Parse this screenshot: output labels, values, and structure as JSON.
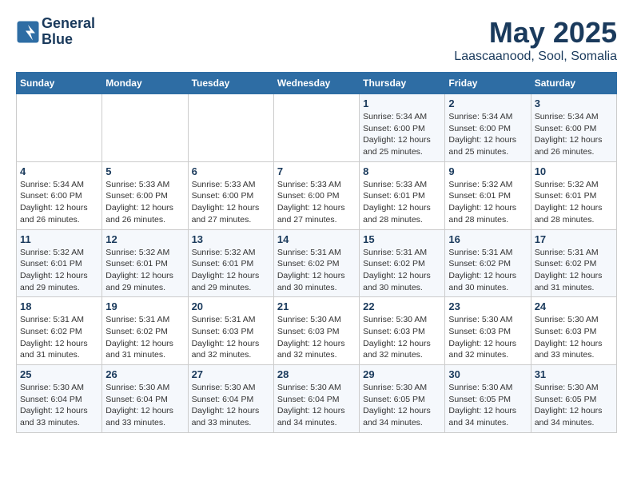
{
  "header": {
    "logo_line1": "General",
    "logo_line2": "Blue",
    "title": "May 2025",
    "subtitle": "Laascaanood, Sool, Somalia"
  },
  "days_of_week": [
    "Sunday",
    "Monday",
    "Tuesday",
    "Wednesday",
    "Thursday",
    "Friday",
    "Saturday"
  ],
  "weeks": [
    [
      {
        "day": "",
        "info": ""
      },
      {
        "day": "",
        "info": ""
      },
      {
        "day": "",
        "info": ""
      },
      {
        "day": "",
        "info": ""
      },
      {
        "day": "1",
        "info": "Sunrise: 5:34 AM\nSunset: 6:00 PM\nDaylight: 12 hours\nand 25 minutes."
      },
      {
        "day": "2",
        "info": "Sunrise: 5:34 AM\nSunset: 6:00 PM\nDaylight: 12 hours\nand 25 minutes."
      },
      {
        "day": "3",
        "info": "Sunrise: 5:34 AM\nSunset: 6:00 PM\nDaylight: 12 hours\nand 26 minutes."
      }
    ],
    [
      {
        "day": "4",
        "info": "Sunrise: 5:34 AM\nSunset: 6:00 PM\nDaylight: 12 hours\nand 26 minutes."
      },
      {
        "day": "5",
        "info": "Sunrise: 5:33 AM\nSunset: 6:00 PM\nDaylight: 12 hours\nand 26 minutes."
      },
      {
        "day": "6",
        "info": "Sunrise: 5:33 AM\nSunset: 6:00 PM\nDaylight: 12 hours\nand 27 minutes."
      },
      {
        "day": "7",
        "info": "Sunrise: 5:33 AM\nSunset: 6:00 PM\nDaylight: 12 hours\nand 27 minutes."
      },
      {
        "day": "8",
        "info": "Sunrise: 5:33 AM\nSunset: 6:01 PM\nDaylight: 12 hours\nand 28 minutes."
      },
      {
        "day": "9",
        "info": "Sunrise: 5:32 AM\nSunset: 6:01 PM\nDaylight: 12 hours\nand 28 minutes."
      },
      {
        "day": "10",
        "info": "Sunrise: 5:32 AM\nSunset: 6:01 PM\nDaylight: 12 hours\nand 28 minutes."
      }
    ],
    [
      {
        "day": "11",
        "info": "Sunrise: 5:32 AM\nSunset: 6:01 PM\nDaylight: 12 hours\nand 29 minutes."
      },
      {
        "day": "12",
        "info": "Sunrise: 5:32 AM\nSunset: 6:01 PM\nDaylight: 12 hours\nand 29 minutes."
      },
      {
        "day": "13",
        "info": "Sunrise: 5:32 AM\nSunset: 6:01 PM\nDaylight: 12 hours\nand 29 minutes."
      },
      {
        "day": "14",
        "info": "Sunrise: 5:31 AM\nSunset: 6:02 PM\nDaylight: 12 hours\nand 30 minutes."
      },
      {
        "day": "15",
        "info": "Sunrise: 5:31 AM\nSunset: 6:02 PM\nDaylight: 12 hours\nand 30 minutes."
      },
      {
        "day": "16",
        "info": "Sunrise: 5:31 AM\nSunset: 6:02 PM\nDaylight: 12 hours\nand 30 minutes."
      },
      {
        "day": "17",
        "info": "Sunrise: 5:31 AM\nSunset: 6:02 PM\nDaylight: 12 hours\nand 31 minutes."
      }
    ],
    [
      {
        "day": "18",
        "info": "Sunrise: 5:31 AM\nSunset: 6:02 PM\nDaylight: 12 hours\nand 31 minutes."
      },
      {
        "day": "19",
        "info": "Sunrise: 5:31 AM\nSunset: 6:02 PM\nDaylight: 12 hours\nand 31 minutes."
      },
      {
        "day": "20",
        "info": "Sunrise: 5:31 AM\nSunset: 6:03 PM\nDaylight: 12 hours\nand 32 minutes."
      },
      {
        "day": "21",
        "info": "Sunrise: 5:30 AM\nSunset: 6:03 PM\nDaylight: 12 hours\nand 32 minutes."
      },
      {
        "day": "22",
        "info": "Sunrise: 5:30 AM\nSunset: 6:03 PM\nDaylight: 12 hours\nand 32 minutes."
      },
      {
        "day": "23",
        "info": "Sunrise: 5:30 AM\nSunset: 6:03 PM\nDaylight: 12 hours\nand 32 minutes."
      },
      {
        "day": "24",
        "info": "Sunrise: 5:30 AM\nSunset: 6:03 PM\nDaylight: 12 hours\nand 33 minutes."
      }
    ],
    [
      {
        "day": "25",
        "info": "Sunrise: 5:30 AM\nSunset: 6:04 PM\nDaylight: 12 hours\nand 33 minutes."
      },
      {
        "day": "26",
        "info": "Sunrise: 5:30 AM\nSunset: 6:04 PM\nDaylight: 12 hours\nand 33 minutes."
      },
      {
        "day": "27",
        "info": "Sunrise: 5:30 AM\nSunset: 6:04 PM\nDaylight: 12 hours\nand 33 minutes."
      },
      {
        "day": "28",
        "info": "Sunrise: 5:30 AM\nSunset: 6:04 PM\nDaylight: 12 hours\nand 34 minutes."
      },
      {
        "day": "29",
        "info": "Sunrise: 5:30 AM\nSunset: 6:05 PM\nDaylight: 12 hours\nand 34 minutes."
      },
      {
        "day": "30",
        "info": "Sunrise: 5:30 AM\nSunset: 6:05 PM\nDaylight: 12 hours\nand 34 minutes."
      },
      {
        "day": "31",
        "info": "Sunrise: 5:30 AM\nSunset: 6:05 PM\nDaylight: 12 hours\nand 34 minutes."
      }
    ]
  ]
}
